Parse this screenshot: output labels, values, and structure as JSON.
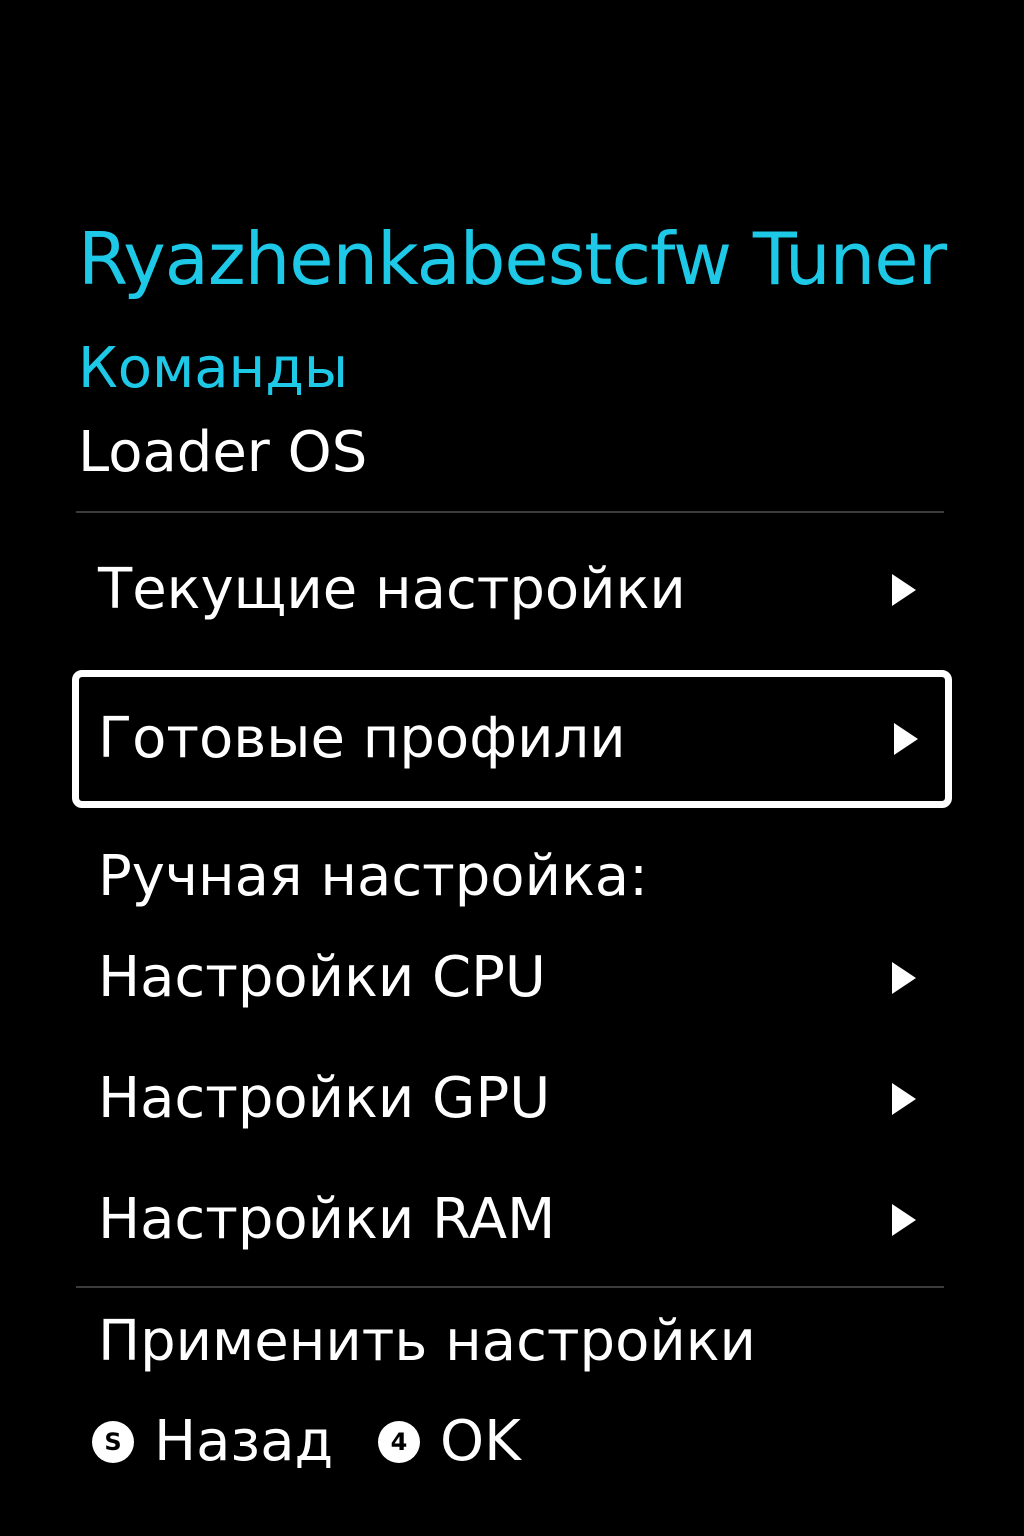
{
  "colors": {
    "background": "#000000",
    "accent": "#1ec9e8",
    "text": "#ffffff",
    "divider": "#3c3c3c"
  },
  "header": {
    "app_title": "Ryazhenkabestcfw Tuner",
    "section_title": "Команды",
    "subtitle": "Loader OS"
  },
  "menu": {
    "current_settings": "Текущие настройки",
    "ready_profiles": "Готовые профили",
    "manual_header": "Ручная настройка:",
    "cpu_settings": "Настройки CPU",
    "gpu_settings": "Настройки GPU",
    "ram_settings": "Настройки RAM",
    "apply_settings": "Применить настройки",
    "selected_item": "Готовые профили"
  },
  "footer": {
    "back_icon": "S",
    "back_label": "Назад",
    "ok_icon": "4",
    "ok_label": "OK"
  }
}
